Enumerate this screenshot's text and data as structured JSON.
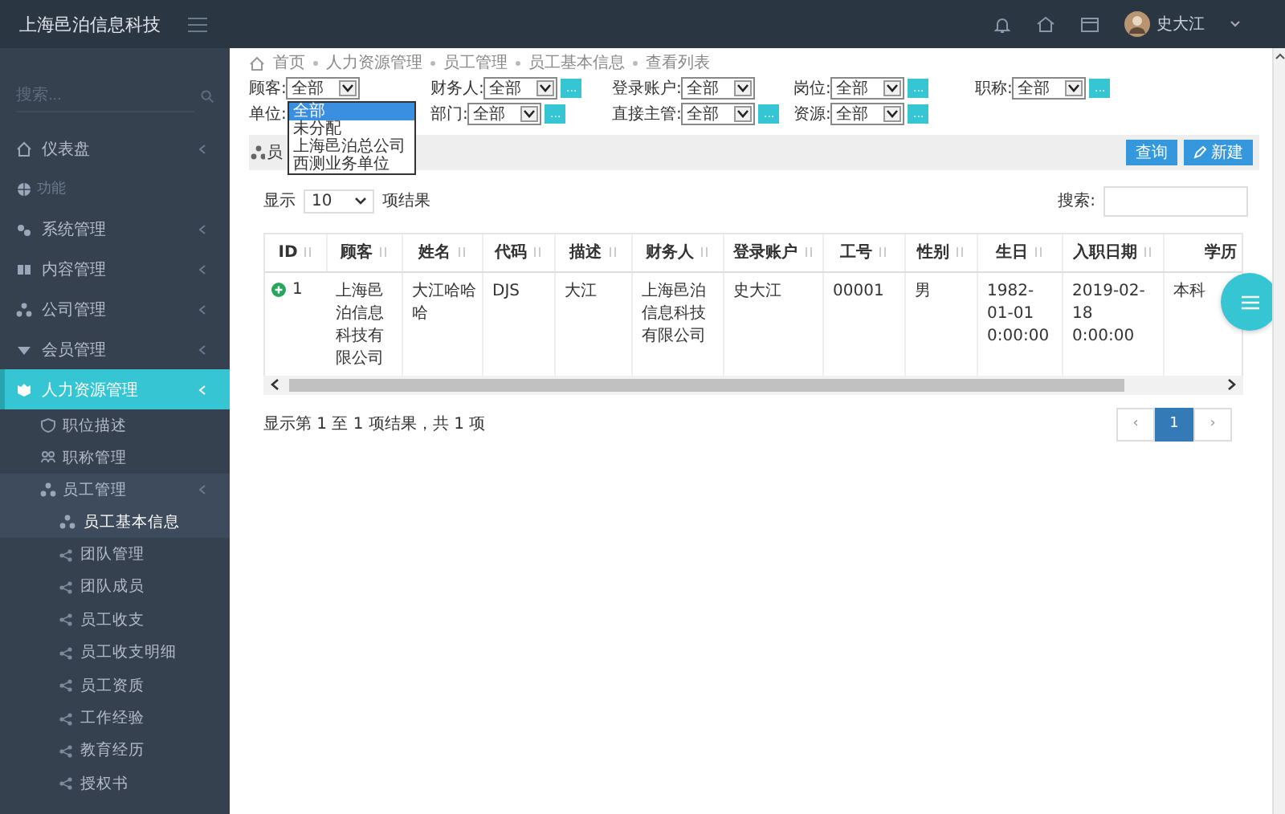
{
  "topbar": {
    "brand": "上海邑泊信息科技",
    "user": "史大江"
  },
  "sidebar": {
    "search": {
      "placeholder": "搜索..."
    },
    "items": [
      {
        "kind": "item",
        "label": "仪表盘",
        "selected": false
      },
      {
        "kind": "section",
        "label": "功能"
      },
      {
        "kind": "item",
        "label": "系统管理",
        "selected": false
      },
      {
        "kind": "item",
        "label": "内容管理",
        "selected": false
      },
      {
        "kind": "item",
        "label": "公司管理",
        "selected": false
      },
      {
        "kind": "item",
        "label": "会员管理",
        "selected": false
      },
      {
        "kind": "item",
        "label": "人力资源管理",
        "selected": true,
        "expanded": true,
        "children": [
          {
            "label": "职位描述",
            "selected": false
          },
          {
            "label": "职称管理",
            "selected": false
          },
          {
            "label": "员工管理",
            "selected": false,
            "expanded": true,
            "children": [
              {
                "label": "员工基本信息",
                "selected": true
              },
              {
                "label": "团队管理",
                "selected": false
              },
              {
                "label": "团队成员",
                "selected": false
              },
              {
                "label": "员工收支",
                "selected": false
              },
              {
                "label": "员工收支明细",
                "selected": false
              },
              {
                "label": "员工资质",
                "selected": false
              },
              {
                "label": "工作经验",
                "selected": false
              },
              {
                "label": "教育经历",
                "selected": false
              },
              {
                "label": "授权书",
                "selected": false
              }
            ]
          }
        ]
      }
    ]
  },
  "breadcrumb": [
    "首页",
    "人力资源管理",
    "员工管理",
    "员工基本信息",
    "查看列表"
  ],
  "filters": [
    [
      {
        "label": "顾客:",
        "value": "全部"
      },
      {
        "label": "财务人:",
        "value": "全部",
        "button": "..."
      },
      {
        "label": "登录账户:",
        "value": "全部"
      },
      {
        "label": "岗位:",
        "value": "全部",
        "button": "..."
      },
      {
        "label": "职称:",
        "value": "全部",
        "button": "..."
      }
    ],
    [
      {
        "label": "单位:",
        "open": true,
        "options": [
          {
            "label": "全部",
            "selected": true
          },
          {
            "label": "未分配",
            "selected": false
          },
          {
            "label": "上海邑泊总公司",
            "selected": false
          },
          {
            "label": "西测业务单位",
            "selected": false
          }
        ]
      },
      {
        "label": "部门:",
        "value": "全部",
        "button": "..."
      },
      {
        "label": "直接主管:",
        "value": "全部",
        "button": "..."
      },
      {
        "label": "资源:",
        "value": "全部",
        "button": "..."
      }
    ]
  ],
  "panel": {
    "title": "员",
    "buttons": [
      {
        "label": "查询",
        "kind": "plain"
      },
      {
        "label": "新建",
        "kind": "edit"
      }
    ]
  },
  "length": {
    "before": "显示",
    "value": "10",
    "after": "项结果"
  },
  "search": {
    "label": "搜索:"
  },
  "table": {
    "columns": [
      "ID",
      "顾客",
      "姓名",
      "代码",
      "描述",
      "财务人",
      "登录账户",
      "工号",
      "性别",
      "生日",
      "入职日期",
      "学历"
    ],
    "rows": [
      [
        "1",
        "上海邑泊信息科技有限公司",
        "大江哈哈哈",
        "DJS",
        "大江",
        "上海邑泊信息科技有限公司",
        "史大江",
        "00001",
        "男",
        "1982-01-01 0:00:00",
        "2019-02-18 0:00:00",
        "本科"
      ]
    ]
  },
  "info": "显示第 1 至 1 项结果，共 1 项",
  "pagination": [
    {
      "label": "‹",
      "selected": false
    },
    {
      "label": "1",
      "selected": true
    },
    {
      "label": "›",
      "selected": false
    }
  ]
}
